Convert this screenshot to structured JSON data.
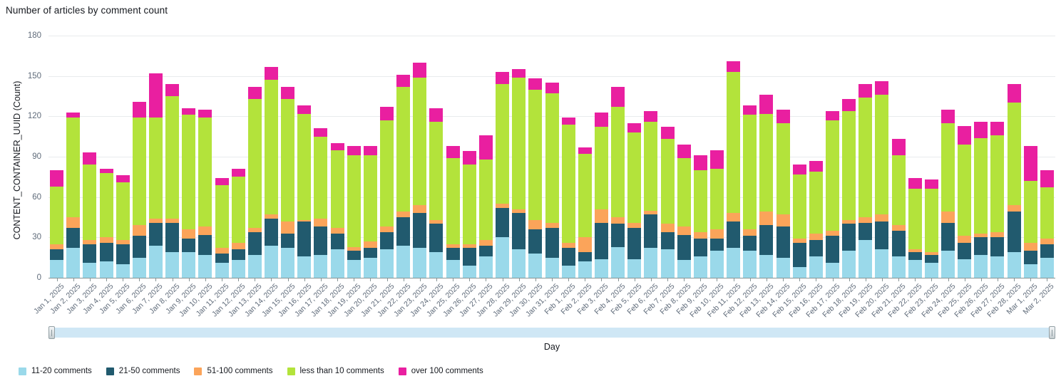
{
  "header": {
    "title": "Number of articles by comment count"
  },
  "axes": {
    "y_title": "CONTENT_CONTAINER_UUID (Count)",
    "x_title": "Day",
    "y_ticks": [
      "0",
      "30",
      "60",
      "90",
      "120",
      "150",
      "180"
    ]
  },
  "legend": [
    {
      "label": "11-20 comments",
      "color": "#9ad9ea"
    },
    {
      "label": "21-50 comments",
      "color": "#215a6e"
    },
    {
      "label": "51-100 comments",
      "color": "#fba45a"
    },
    {
      "label": "less than 10 comments",
      "color": "#b3e33b"
    },
    {
      "label": "over 100 comments",
      "color": "#e91fa0"
    }
  ],
  "slider": {
    "left_handle": "range-start-handle",
    "right_handle": "range-end-handle"
  },
  "chart_data": {
    "type": "bar",
    "title": "Number of articles by comment count",
    "xlabel": "Day",
    "ylabel": "CONTENT_CONTAINER_UUID (Count)",
    "ylim": [
      0,
      180
    ],
    "yticks": [
      0,
      30,
      60,
      90,
      120,
      150,
      180
    ],
    "grid": true,
    "stacked": true,
    "legend_position": "bottom-left",
    "colors": {
      "11-20 comments": "#9ad9ea",
      "21-50 comments": "#215a6e",
      "51-100 comments": "#fba45a",
      "less than 10 comments": "#b3e33b",
      "over 100 comments": "#e91fa0"
    },
    "stack_order": [
      "11-20 comments",
      "21-50 comments",
      "51-100 comments",
      "less than 10 comments",
      "over 100 comments"
    ],
    "categories": [
      "Jan 1, 2025",
      "Jan 2, 2025",
      "Jan 3, 2025",
      "Jan 4, 2025",
      "Jan 5, 2025",
      "Jan 6, 2025",
      "Jan 7, 2025",
      "Jan 8, 2025",
      "Jan 9, 2025",
      "Jan 10, 2025",
      "Jan 11, 2025",
      "Jan 12, 2025",
      "Jan 13, 2025",
      "Jan 14, 2025",
      "Jan 15, 2025",
      "Jan 16, 2025",
      "Jan 17, 2025",
      "Jan 18, 2025",
      "Jan 19, 2025",
      "Jan 20, 2025",
      "Jan 21, 2025",
      "Jan 22, 2025",
      "Jan 23, 2025",
      "Jan 24, 2025",
      "Jan 25, 2025",
      "Jan 26, 2025",
      "Jan 27, 2025",
      "Jan 28, 2025",
      "Jan 29, 2025",
      "Jan 30, 2025",
      "Jan 31, 2025",
      "Feb 1, 2025",
      "Feb 2, 2025",
      "Feb 3, 2025",
      "Feb 4, 2025",
      "Feb 5, 2025",
      "Feb 6, 2025",
      "Feb 7, 2025",
      "Feb 8, 2025",
      "Feb 9, 2025",
      "Feb 10, 2025",
      "Feb 11, 2025",
      "Feb 12, 2025",
      "Feb 13, 2025",
      "Feb 14, 2025",
      "Feb 15, 2025",
      "Feb 16, 2025",
      "Feb 17, 2025",
      "Feb 18, 2025",
      "Feb 19, 2025",
      "Feb 20, 2025",
      "Feb 21, 2025",
      "Feb 22, 2025",
      "Feb 23, 2025",
      "Feb 24, 2025",
      "Feb 25, 2025",
      "Feb 26, 2025",
      "Feb 27, 2025",
      "Feb 28, 2025",
      "Mar 1, 2025",
      "Mar 2, 2025"
    ],
    "series": [
      {
        "name": "11-20 comments",
        "color": "#9ad9ea",
        "values": [
          13,
          22,
          11,
          12,
          10,
          15,
          24,
          19,
          19,
          17,
          11,
          13,
          17,
          24,
          22,
          16,
          17,
          21,
          13,
          15,
          21,
          24,
          22,
          19,
          13,
          9,
          16,
          30,
          21,
          18,
          15,
          9,
          12,
          14,
          23,
          14,
          22,
          21,
          13,
          16,
          20,
          22,
          20,
          17,
          15,
          8,
          16,
          11,
          20,
          28,
          21,
          16,
          13,
          11,
          20,
          14,
          17,
          16,
          19,
          10,
          15
        ]
      },
      {
        "name": "21-50 comments",
        "color": "#215a6e",
        "values": [
          8,
          15,
          14,
          14,
          15,
          16,
          17,
          22,
          10,
          15,
          7,
          8,
          17,
          20,
          11,
          26,
          21,
          12,
          7,
          7,
          13,
          21,
          26,
          21,
          9,
          13,
          8,
          22,
          27,
          18,
          22,
          13,
          7,
          27,
          17,
          23,
          25,
          13,
          19,
          13,
          9,
          20,
          11,
          22,
          23,
          18,
          12,
          20,
          20,
          13,
          21,
          19,
          6,
          6,
          21,
          12,
          13,
          14,
          30,
          10,
          10
        ]
      },
      {
        "name": "51-100 comments",
        "color": "#fba45a",
        "values": [
          4,
          8,
          3,
          4,
          3,
          8,
          3,
          3,
          7,
          6,
          4,
          5,
          3,
          3,
          9,
          1,
          6,
          4,
          3,
          5,
          4,
          4,
          6,
          3,
          3,
          3,
          4,
          3,
          3,
          7,
          4,
          4,
          11,
          10,
          5,
          4,
          3,
          6,
          6,
          5,
          7,
          6,
          5,
          10,
          9,
          3,
          5,
          4,
          3,
          4,
          5,
          4,
          2,
          2,
          8,
          5,
          3,
          4,
          5,
          6,
          4
        ]
      },
      {
        "name": "less than 10 comments",
        "color": "#b3e33b",
        "values": [
          43,
          74,
          56,
          48,
          43,
          80,
          75,
          91,
          85,
          81,
          47,
          49,
          96,
          100,
          91,
          79,
          61,
          58,
          68,
          64,
          79,
          93,
          95,
          73,
          64,
          59,
          60,
          89,
          98,
          97,
          96,
          88,
          62,
          61,
          82,
          67,
          66,
          63,
          51,
          46,
          45,
          105,
          85,
          73,
          68,
          48,
          46,
          82,
          81,
          89,
          89,
          52,
          45,
          47,
          66,
          68,
          71,
          72,
          76,
          46,
          38
        ]
      },
      {
        "name": "over 100 comments",
        "color": "#e91fa0",
        "values": [
          12,
          4,
          9,
          3,
          5,
          12,
          33,
          9,
          5,
          6,
          5,
          6,
          9,
          10,
          9,
          6,
          6,
          5,
          7,
          7,
          10,
          9,
          11,
          10,
          9,
          10,
          18,
          9,
          6,
          8,
          8,
          5,
          5,
          11,
          15,
          7,
          8,
          9,
          10,
          11,
          14,
          8,
          7,
          14,
          10,
          7,
          8,
          7,
          9,
          10,
          10,
          12,
          8,
          7,
          10,
          14,
          12,
          10,
          14,
          26,
          13
        ]
      }
    ]
  }
}
